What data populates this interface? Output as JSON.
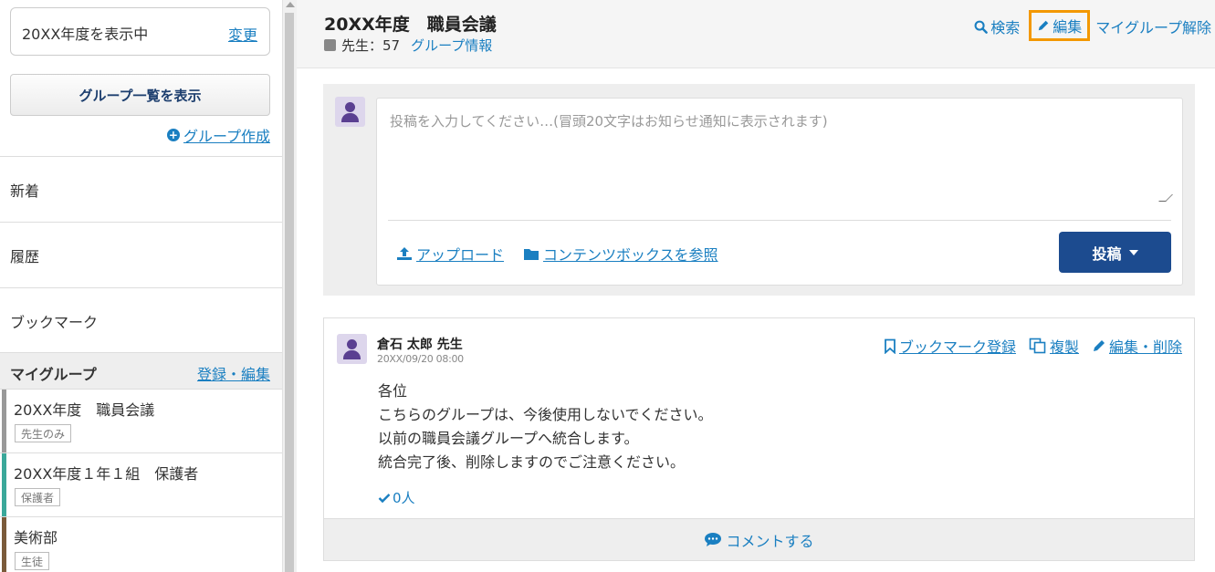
{
  "sidebar": {
    "year_display": "20XX年度を表示中",
    "year_change": "変更",
    "group_list_button": "グループ一覧を表示",
    "create_group": "グループ作成",
    "nav": [
      "新着",
      "履歴",
      "ブックマーク"
    ],
    "mygroup_title": "マイグループ",
    "mygroup_edit": "登録・編集",
    "groups": [
      {
        "name": "20XX年度　職員会議",
        "tag": "先生のみ",
        "color": "#999999"
      },
      {
        "name": "20XX年度１年１組　保護者",
        "tag": "保護者",
        "color": "#3aa89a"
      },
      {
        "name": "美術部",
        "tag": "生徒",
        "color": "#7a5a3a"
      }
    ]
  },
  "header": {
    "title": "20XX年度　職員会議",
    "members": "先生：57",
    "group_info": "グループ情報",
    "search": "検索",
    "edit": "編集",
    "leave_mygroup": "マイグループ解除"
  },
  "composer": {
    "placeholder": "投稿を入力してください…(冒頭20文字はお知らせ通知に表示されます)",
    "upload": "アップロード",
    "contents_box": "コンテンツボックスを参照",
    "post_button": "投稿"
  },
  "message": {
    "author": "倉石 太郎 先生",
    "date": "20XX/09/20 08:00",
    "bookmark": "ブックマーク登録",
    "duplicate": "複製",
    "edit_delete": "編集・削除",
    "lines": [
      "各位",
      "こちらのグループは、今後使用しないでください。",
      "以前の職員会議グループへ統合します。",
      "統合完了後、削除しますのでご注意ください。"
    ],
    "likes": "0人",
    "comment": "コメントする"
  },
  "colors": {
    "link": "#1a7fc1",
    "post_button": "#1c4b8f",
    "highlight": "#f39800"
  }
}
